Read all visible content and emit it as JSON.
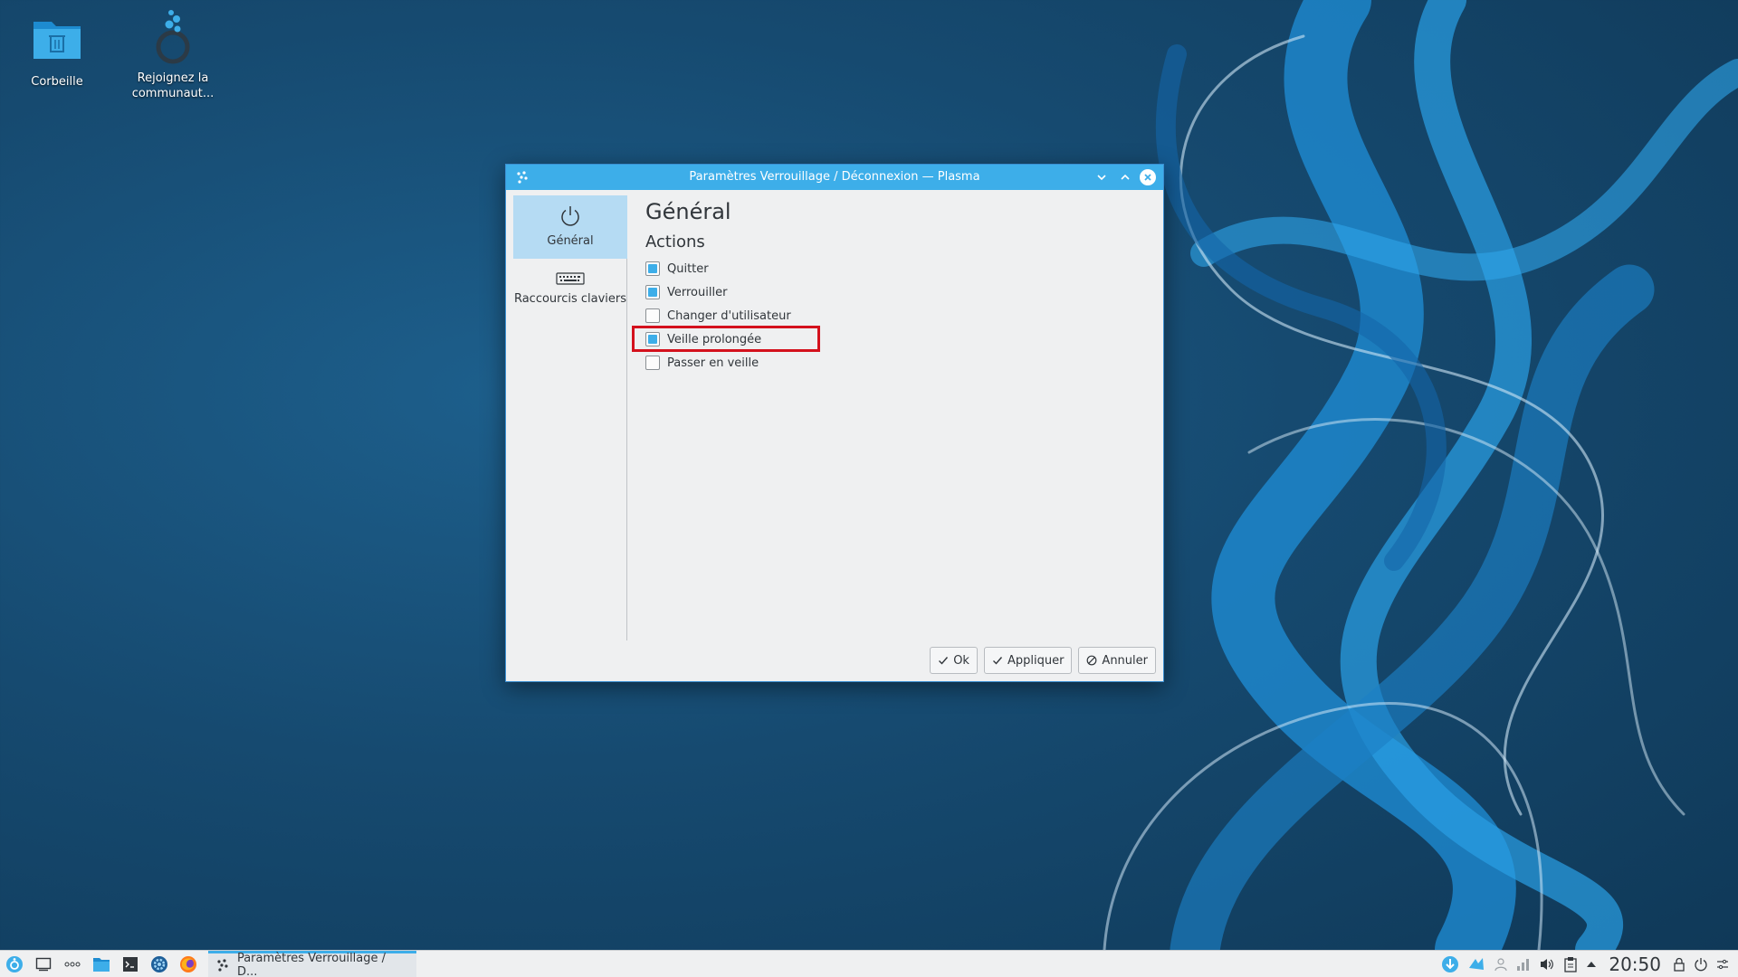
{
  "desktop": {
    "icons": [
      {
        "label": "Corbeille",
        "icon": "trash-folder-icon"
      },
      {
        "label": "Rejoignez la communaut...",
        "icon": "community-icon"
      }
    ]
  },
  "window": {
    "title": "Paramètres Verrouillage / Déconnexion — Plasma",
    "sidebar": [
      {
        "label": "Général",
        "icon": "power-icon",
        "active": true
      },
      {
        "label": "Raccourcis claviers",
        "icon": "keyboard-icon",
        "active": false
      }
    ],
    "heading": "Général",
    "section": "Actions",
    "checkboxes": [
      {
        "label": "Quitter",
        "checked": true
      },
      {
        "label": "Verrouiller",
        "checked": true
      },
      {
        "label": "Changer d'utilisateur",
        "checked": false
      },
      {
        "label": "Veille prolongée",
        "checked": true
      },
      {
        "label": "Passer en veille",
        "checked": false
      }
    ],
    "buttons": {
      "ok": "Ok",
      "apply": "Appliquer",
      "cancel": "Annuler"
    }
  },
  "taskbar": {
    "task_label": "Paramètres Verrouillage / D...",
    "clock": "20:50"
  },
  "colors": {
    "accent": "#3daee9",
    "highlight": "#d4111d"
  }
}
